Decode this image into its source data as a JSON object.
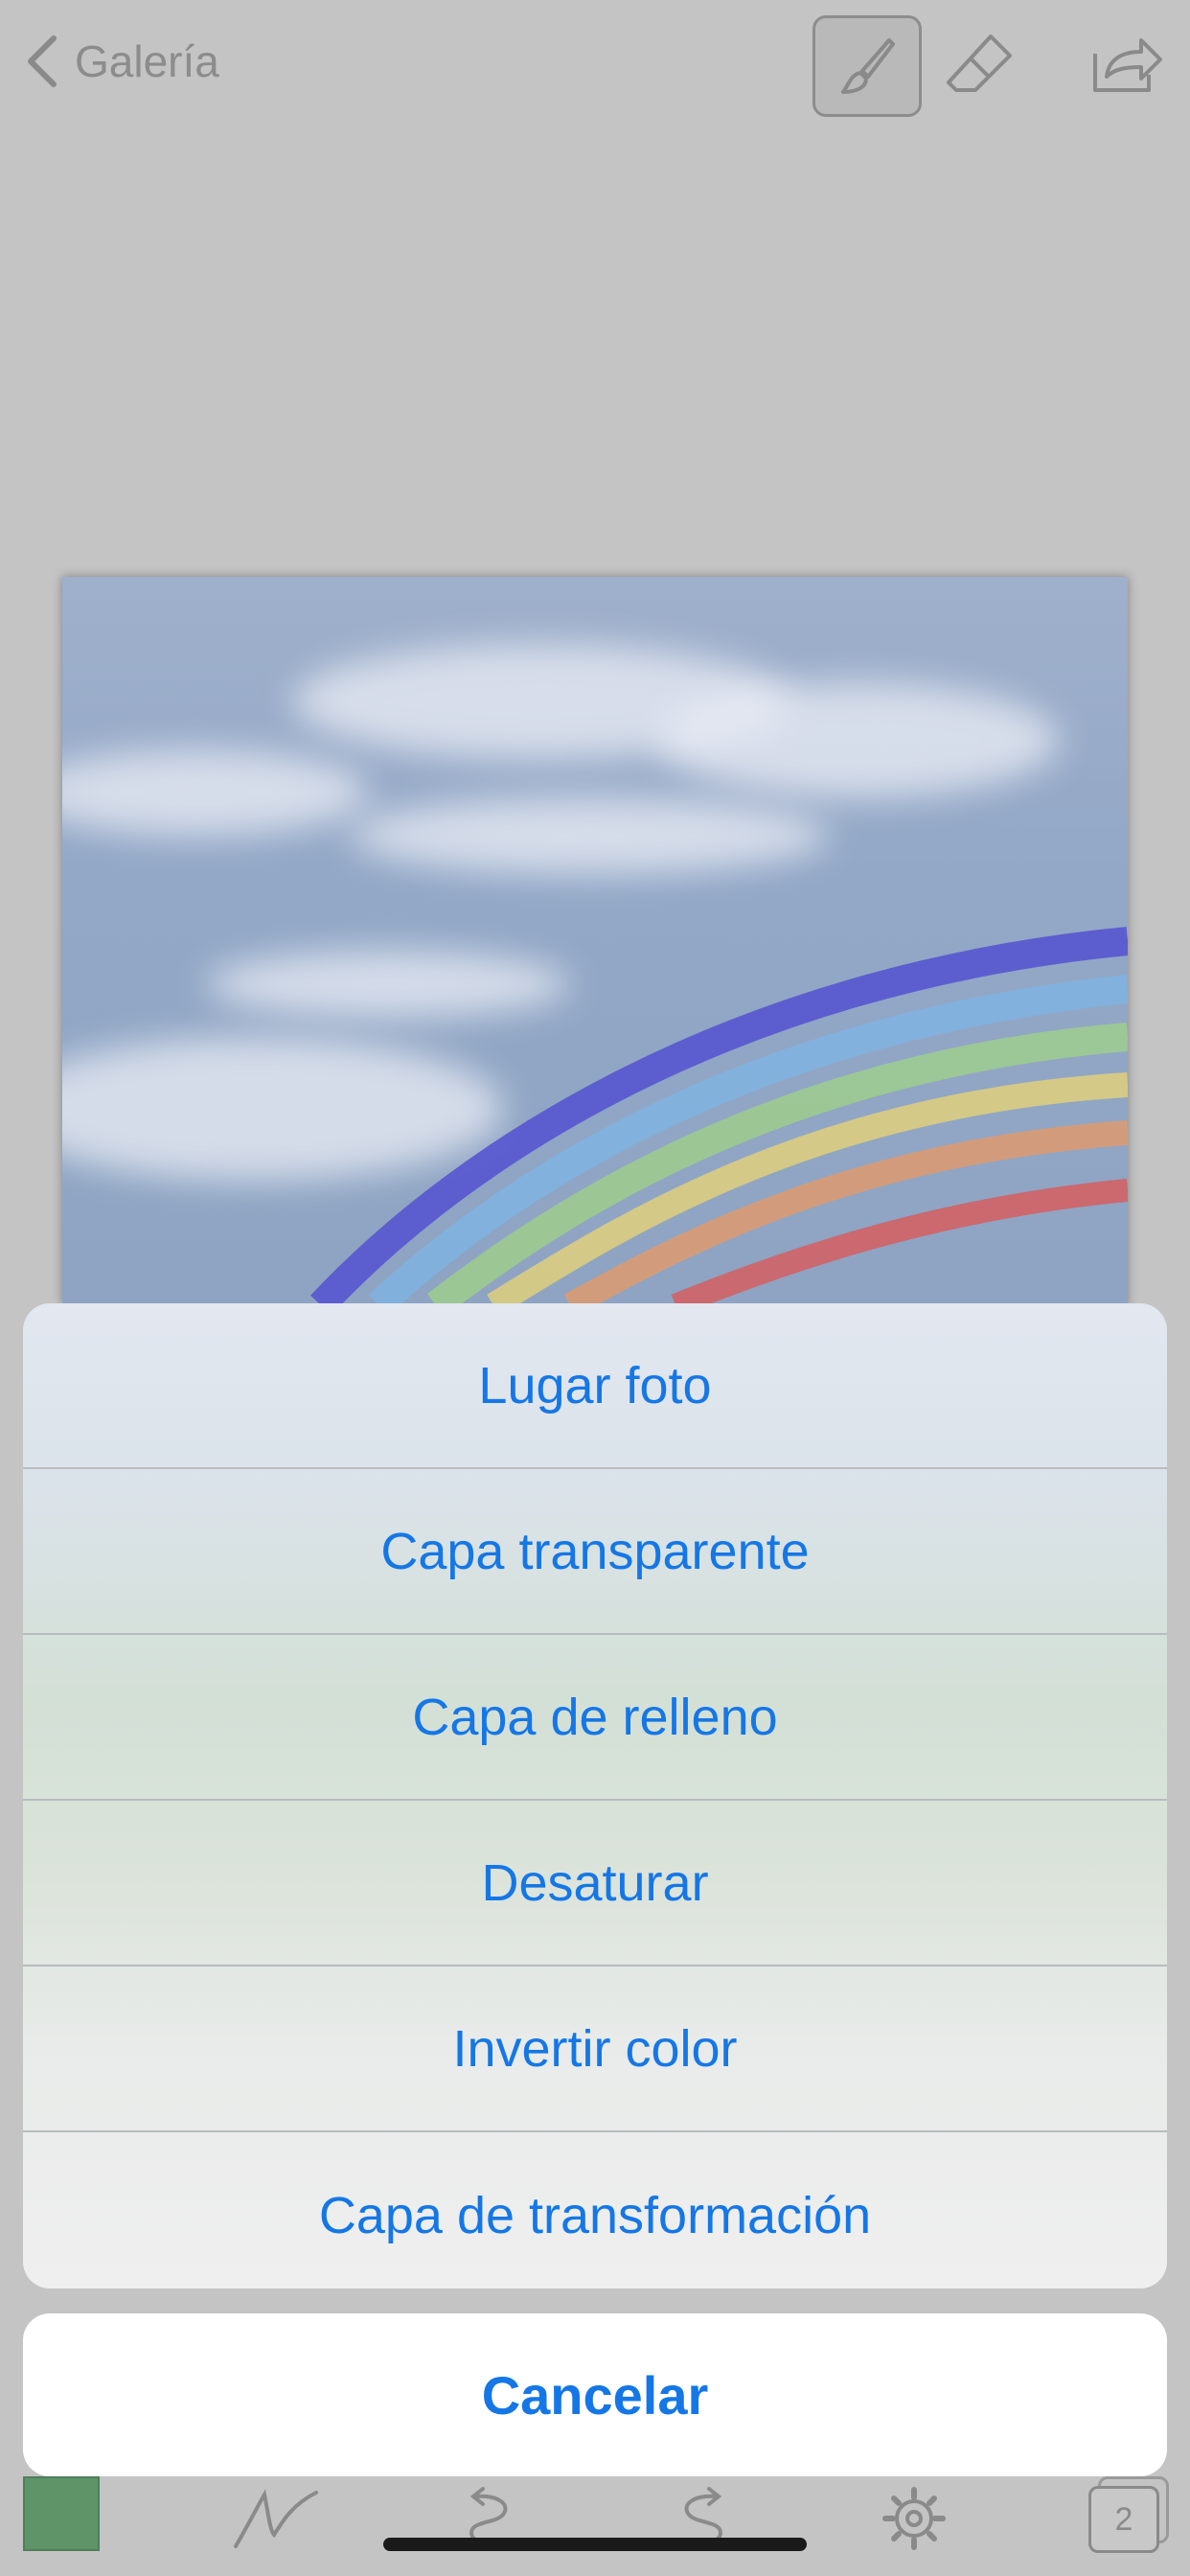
{
  "topbar": {
    "back_label": "Galería",
    "icons": [
      "chevron-left-icon",
      "brush-icon",
      "eraser-icon",
      "share-icon"
    ]
  },
  "action_sheet": {
    "items": [
      {
        "label": "Lugar foto"
      },
      {
        "label": "Capa transparente"
      },
      {
        "label": "Capa de relleno"
      },
      {
        "label": "Desaturar"
      },
      {
        "label": "Invertir color"
      },
      {
        "label": "Capa de transformación"
      }
    ],
    "cancel_label": "Cancelar"
  },
  "bottombar": {
    "current_color": "#5e9468",
    "layers_count": "2",
    "icons": [
      "brush-stroke-icon",
      "undo-icon",
      "redo-icon",
      "settings-icon",
      "layers-icon"
    ]
  },
  "colors": {
    "accent": "#1577e6",
    "background": "#c4c4c4"
  }
}
